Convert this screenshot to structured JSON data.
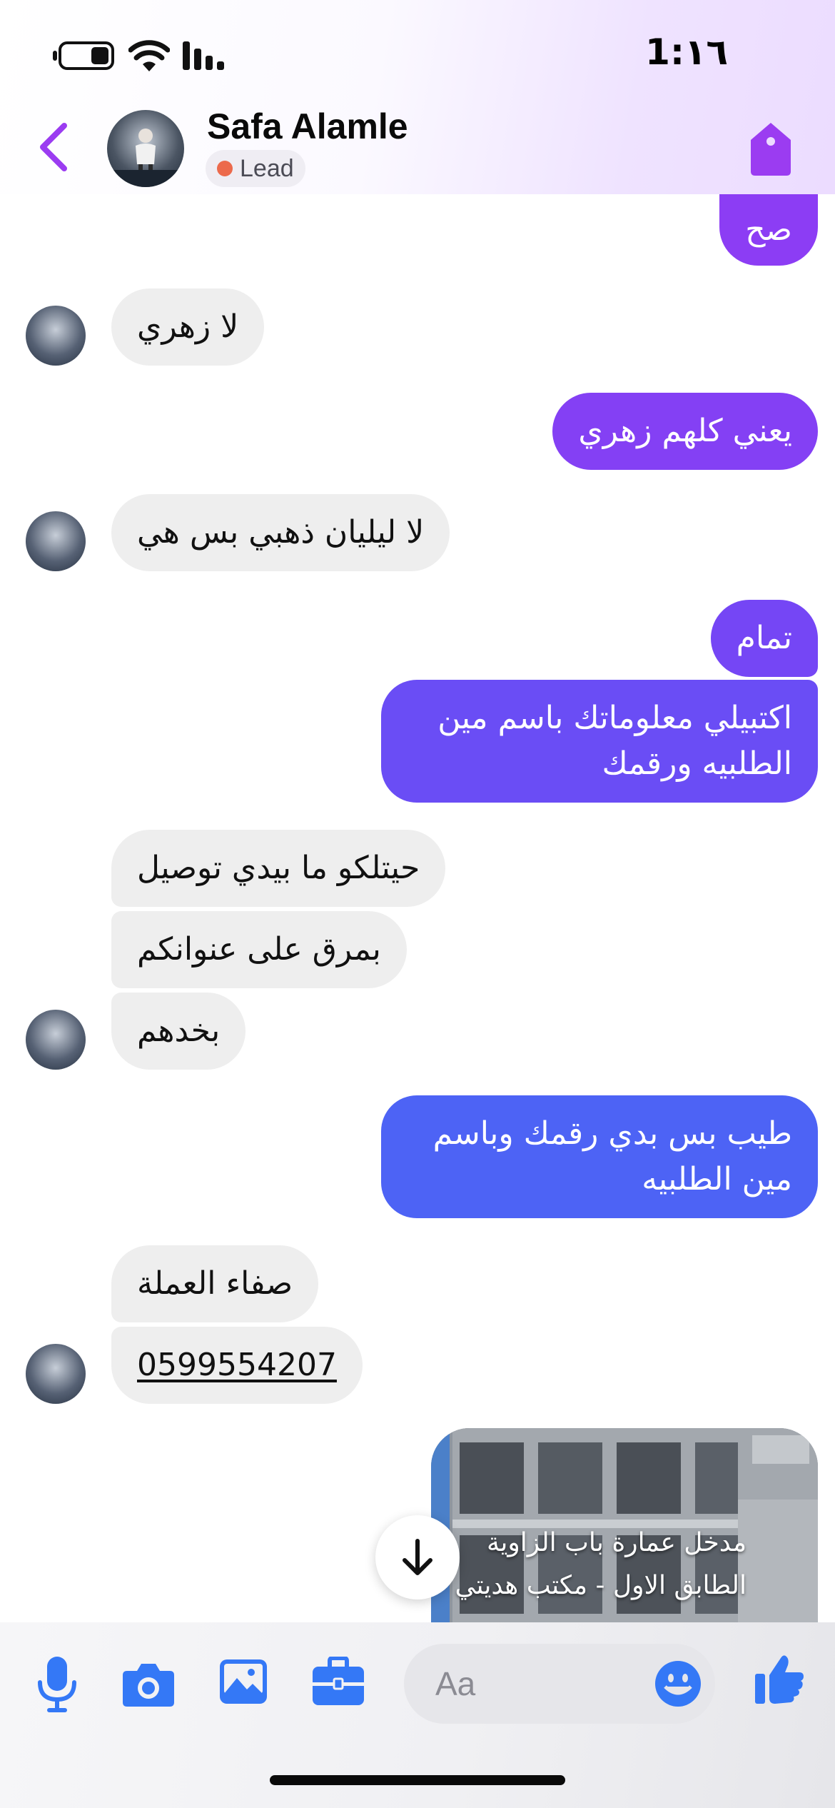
{
  "status_bar": {
    "time": "1:١٦"
  },
  "header": {
    "contact_name": "Safa Alamle",
    "label_badge": "Lead",
    "label_color": "#ec6a4c",
    "accent_color": "#9b3cf1"
  },
  "messages": [
    {
      "direction": "outgoing",
      "text": "صح"
    },
    {
      "direction": "incoming",
      "text": "لا زهري"
    },
    {
      "direction": "outgoing",
      "text": "يعني كلهم زهري"
    },
    {
      "direction": "incoming",
      "text": "لا ليليان ذهبي  بس هي"
    },
    {
      "direction": "outgoing",
      "text": "تمام"
    },
    {
      "direction": "outgoing",
      "text": "اكتبيلي معلوماتك باسم مين الطلبيه ورقمك"
    },
    {
      "direction": "incoming",
      "text": "حيتلكو ما بيدي توصيل"
    },
    {
      "direction": "incoming",
      "text": "بمرق على عنوانكم"
    },
    {
      "direction": "incoming",
      "text": "بخدهم"
    },
    {
      "direction": "outgoing",
      "text": "طيب بس بدي رقمك وباسم مين الطلبيه"
    },
    {
      "direction": "incoming",
      "text": "صفاء العملة"
    },
    {
      "direction": "incoming",
      "text": "0599554207"
    }
  ],
  "image_message": {
    "caption_lines": [
      "مدخل عمارة باب الزاوية",
      "الطابق الاول - مكتب هديتي"
    ]
  },
  "composer": {
    "placeholder": "Aa",
    "icons": [
      "microphone-icon",
      "camera-icon",
      "gallery-icon",
      "briefcase-icon",
      "emoji-icon",
      "thumbs-up-icon"
    ]
  },
  "colors": {
    "outgoing_top": "#8b3df5",
    "outgoing_bottom": "#4667f5",
    "incoming": "#eeeeee",
    "messenger_blue": "#3478f6"
  }
}
